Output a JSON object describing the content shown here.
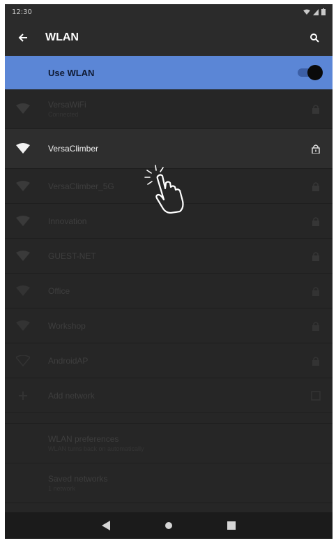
{
  "status_bar": {
    "time": "12:30",
    "icons": [
      "wifi-icon",
      "signal-icon",
      "battery-icon"
    ]
  },
  "app_bar": {
    "title": "WLAN",
    "back_icon": "arrow-left-icon",
    "search_icon": "search-icon"
  },
  "use_wlan": {
    "label": "Use WLAN",
    "enabled": true
  },
  "networks": [
    {
      "name": "VersaWiFi",
      "sub": "Connected",
      "locked": true,
      "active": false
    },
    {
      "name": "VersaClimber",
      "sub": "",
      "locked": true,
      "active": true
    },
    {
      "name": "VersaClimber_5G",
      "sub": "",
      "locked": true,
      "active": false
    },
    {
      "name": "Innovation",
      "sub": "",
      "locked": true,
      "active": false
    },
    {
      "name": "GUEST-NET",
      "sub": "",
      "locked": true,
      "active": false
    },
    {
      "name": "Office",
      "sub": "",
      "locked": true,
      "active": false
    },
    {
      "name": "Workshop",
      "sub": "",
      "locked": true,
      "active": false
    },
    {
      "name": "AndroidAP",
      "sub": "",
      "locked": true,
      "active": false
    }
  ],
  "add_network": {
    "label": "Add network"
  },
  "preferences": {
    "title": "WLAN preferences",
    "sub": "WLAN turns back on automatically"
  },
  "saved": {
    "title": "Saved networks",
    "sub": "1 network"
  },
  "colors": {
    "accent_bar": "#5b86d6",
    "background": "#262626",
    "active_row": "#2e2e2e"
  }
}
